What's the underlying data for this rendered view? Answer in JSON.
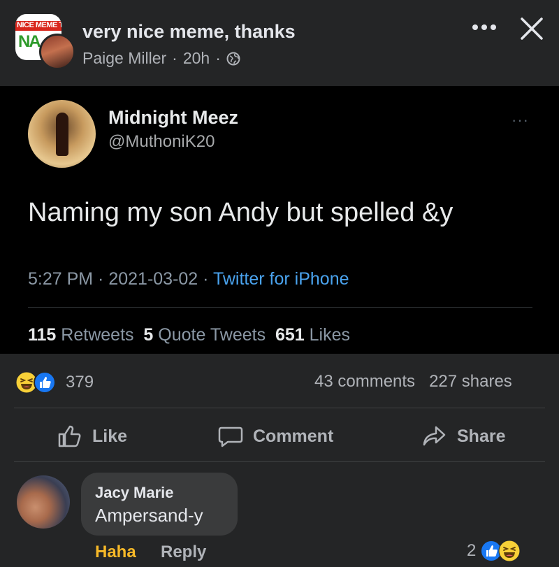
{
  "header": {
    "group_logo_text": "NICE MEME TH",
    "group_logo_big": "NA",
    "title": "very nice meme, thanks",
    "author": "Paige Miller",
    "separator": "·",
    "time": "20h",
    "more_icon": "more-icon",
    "close_icon": "close-icon"
  },
  "tweet": {
    "name": "Midnight Meez",
    "handle": "@MuthoniK20",
    "more": "···",
    "text": "Naming my son Andy but spelled &y",
    "time": "5:27 PM",
    "dot": " · ",
    "date": "2021-03-02",
    "source": "Twitter for iPhone",
    "retweets_count": "115",
    "retweets_label": "Retweets",
    "quotes_count": "5",
    "quotes_label": "Quote Tweets",
    "likes_count": "651",
    "likes_label": "Likes"
  },
  "stats": {
    "reactions": "379",
    "comments": "43 comments",
    "shares": "227 shares"
  },
  "actions": {
    "like": "Like",
    "comment": "Comment",
    "share": "Share"
  },
  "comment": {
    "author": "Jacy Marie",
    "text": "Ampersand-y",
    "haha": "Haha",
    "reply": "Reply",
    "reaction_count": "2"
  },
  "colors": {
    "background": "#242526",
    "tweet_bg": "#000000",
    "link_blue": "#4aa3ee",
    "haha_yellow": "#f7b928",
    "like_blue": "#1877f2"
  }
}
